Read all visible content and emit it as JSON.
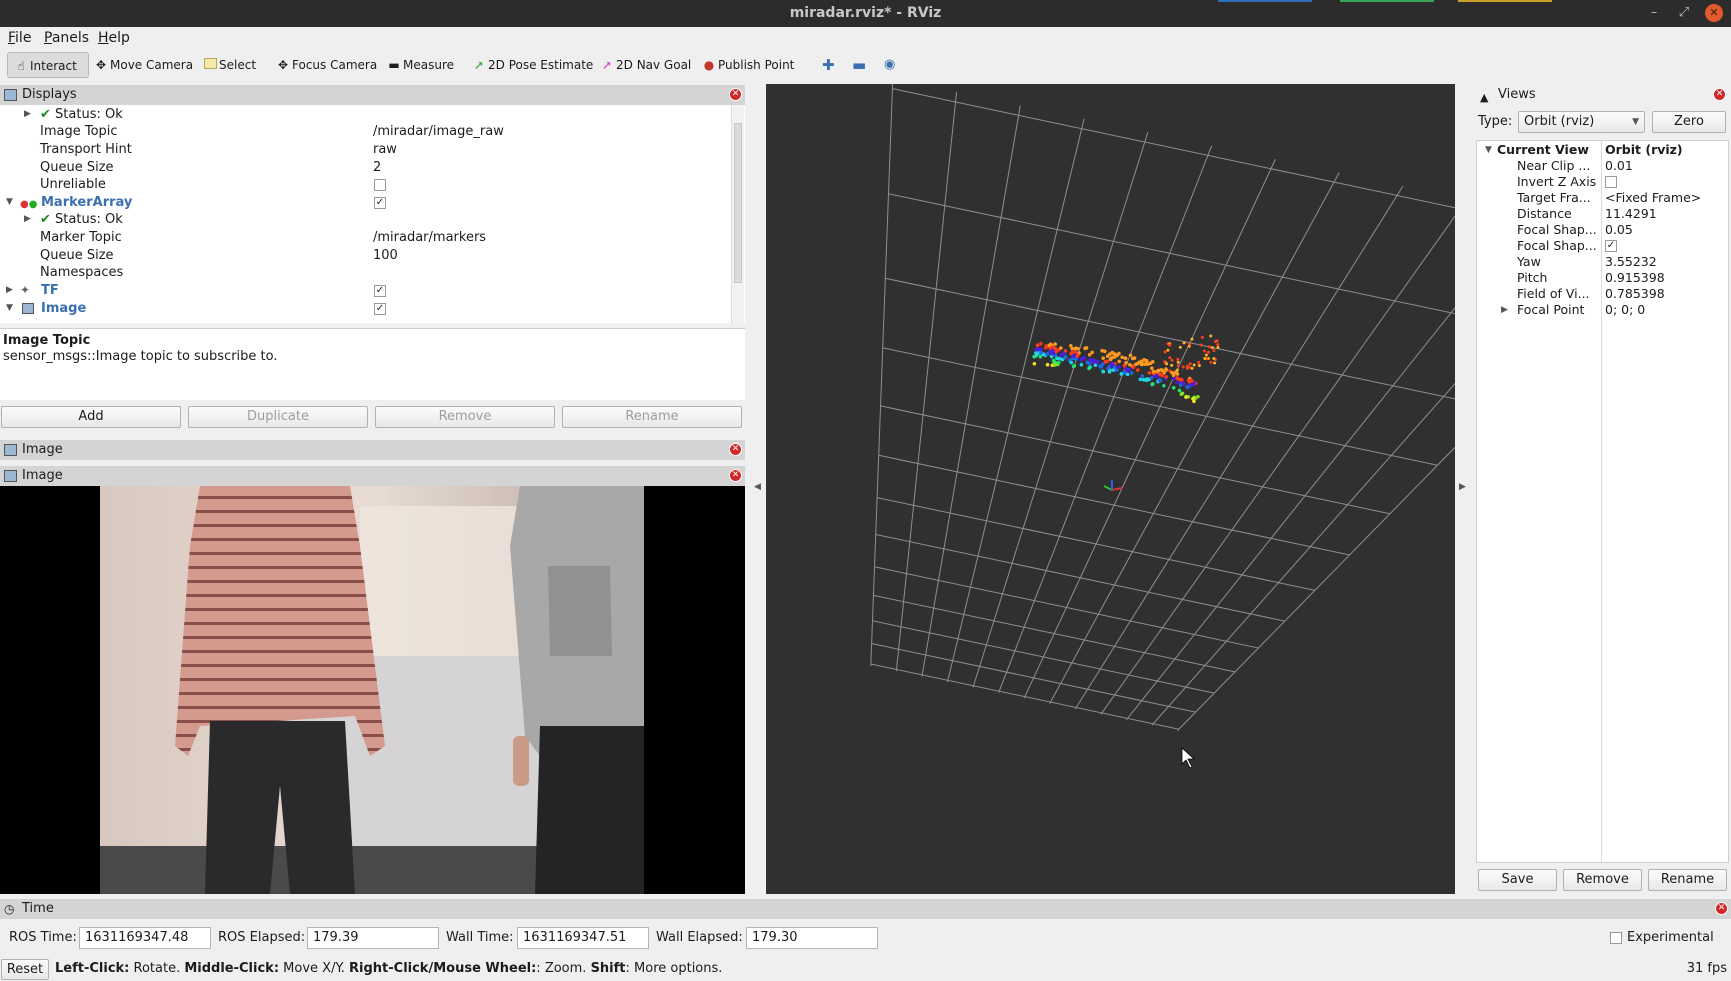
{
  "window": {
    "title": "miradar.rviz* - RViz",
    "buttons": {
      "minimize": "–",
      "maximize": "⤢",
      "close": "✕"
    }
  },
  "menubar": [
    "File",
    "Panels",
    "Help"
  ],
  "toolbar": {
    "tools": [
      {
        "label": "Interact",
        "icon": "hand-icon"
      },
      {
        "label": "Move Camera",
        "icon": "move-camera-icon"
      },
      {
        "label": "Select",
        "icon": "select-icon"
      },
      {
        "label": "Focus Camera",
        "icon": "focus-camera-icon"
      },
      {
        "label": "Measure",
        "icon": "ruler-icon"
      },
      {
        "label": "2D Pose Estimate",
        "icon": "green-arrow-icon"
      },
      {
        "label": "2D Nav Goal",
        "icon": "pink-arrow-icon"
      },
      {
        "label": "Publish Point",
        "icon": "map-pin-icon"
      }
    ],
    "active": "Interact"
  },
  "displays": {
    "title": "Displays",
    "rows": [
      {
        "key": "Status: Ok"
      },
      {
        "key": "Image Topic",
        "value": "/miradar/image_raw"
      },
      {
        "key": "Transport Hint",
        "value": "raw"
      },
      {
        "key": "Queue Size",
        "value": "2"
      },
      {
        "key": "Unreliable"
      },
      {
        "key": "MarkerArray"
      },
      {
        "key": "Status: Ok"
      },
      {
        "key": "Marker Topic",
        "value": "/miradar/markers"
      },
      {
        "key": "Queue Size",
        "value": "100"
      },
      {
        "key": "Namespaces"
      },
      {
        "key": "TF"
      },
      {
        "key": "Image"
      }
    ],
    "description_title": "Image Topic",
    "description_text": "sensor_msgs::Image topic to subscribe to.",
    "buttons": [
      "Add",
      "Duplicate",
      "Remove",
      "Rename"
    ]
  },
  "image_panels": [
    "Image",
    "Image"
  ],
  "views": {
    "title": "Views",
    "type_label": "Type:",
    "type_value": "Orbit (rviz)",
    "zero_label": "Zero",
    "current_view_label": "Current View",
    "current_view_value": "Orbit (rviz)",
    "rows": [
      {
        "key": "Near Clip ...",
        "value": "0.01"
      },
      {
        "key": "Invert Z Axis",
        "value": ""
      },
      {
        "key": "Target Fra...",
        "value": "<Fixed Frame>"
      },
      {
        "key": "Distance",
        "value": "11.4291"
      },
      {
        "key": "Focal Shap...",
        "value": "0.05"
      },
      {
        "key": "Focal Shap...",
        "value": ""
      },
      {
        "key": "Yaw",
        "value": "3.55232"
      },
      {
        "key": "Pitch",
        "value": "0.915398"
      },
      {
        "key": "Field of Vi...",
        "value": "0.785398"
      },
      {
        "key": "Focal Point",
        "value": "0; 0; 0"
      }
    ],
    "buttons": [
      "Save",
      "Remove",
      "Rename"
    ]
  },
  "time": {
    "title": "Time",
    "ros_time_label": "ROS Time:",
    "ros_time": "1631169347.48",
    "ros_elapsed_label": "ROS Elapsed:",
    "ros_elapsed": "179.39",
    "wall_time_label": "Wall Time:",
    "wall_time": "1631169347.51",
    "wall_elapsed_label": "Wall Elapsed:",
    "wall_elapsed": "179.30",
    "experimental_label": "Experimental"
  },
  "statusbar": {
    "reset": "Reset",
    "help_parts": [
      "Left-Click:",
      " Rotate. ",
      "Middle-Click:",
      " Move X/Y. ",
      "Right-Click/Mouse Wheel:",
      ":",
      " Zoom. ",
      "Shift",
      ": More options."
    ],
    "fps": "31 fps"
  },
  "colors": {
    "titlebar": "#2c2c2c",
    "accent_blue": "#3a6fb0",
    "viewport_bg": "#303030",
    "close_red": "#d02828"
  }
}
